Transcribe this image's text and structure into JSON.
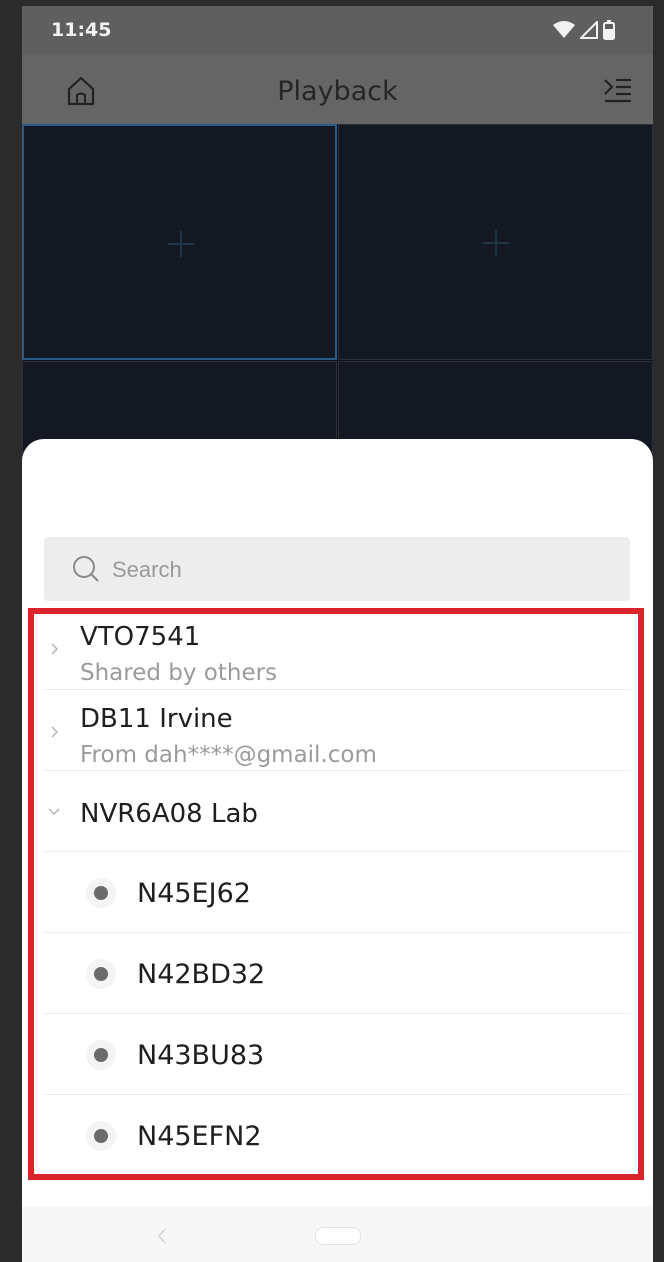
{
  "status_bar": {
    "time": "11:45",
    "icons": [
      "wifi-icon",
      "signal-icon",
      "battery-icon"
    ]
  },
  "header": {
    "title": "Playback",
    "left_icon": "home-icon",
    "right_icon": "menu-icon"
  },
  "search": {
    "placeholder": "Search",
    "value": ""
  },
  "devices": [
    {
      "name": "VTO7541",
      "subtitle": "Shared by others",
      "expanded": false
    },
    {
      "name": "DB11 Irvine",
      "subtitle": "From dah****@gmail.com",
      "expanded": false
    },
    {
      "name": "NVR6A08 Lab",
      "expanded": true,
      "channels": [
        "N45EJ62",
        "N42BD32",
        "N43BU83",
        "N45EFN2"
      ]
    }
  ],
  "colors": {
    "highlight": "#d9242b",
    "active_cell": "#2c5a86"
  }
}
